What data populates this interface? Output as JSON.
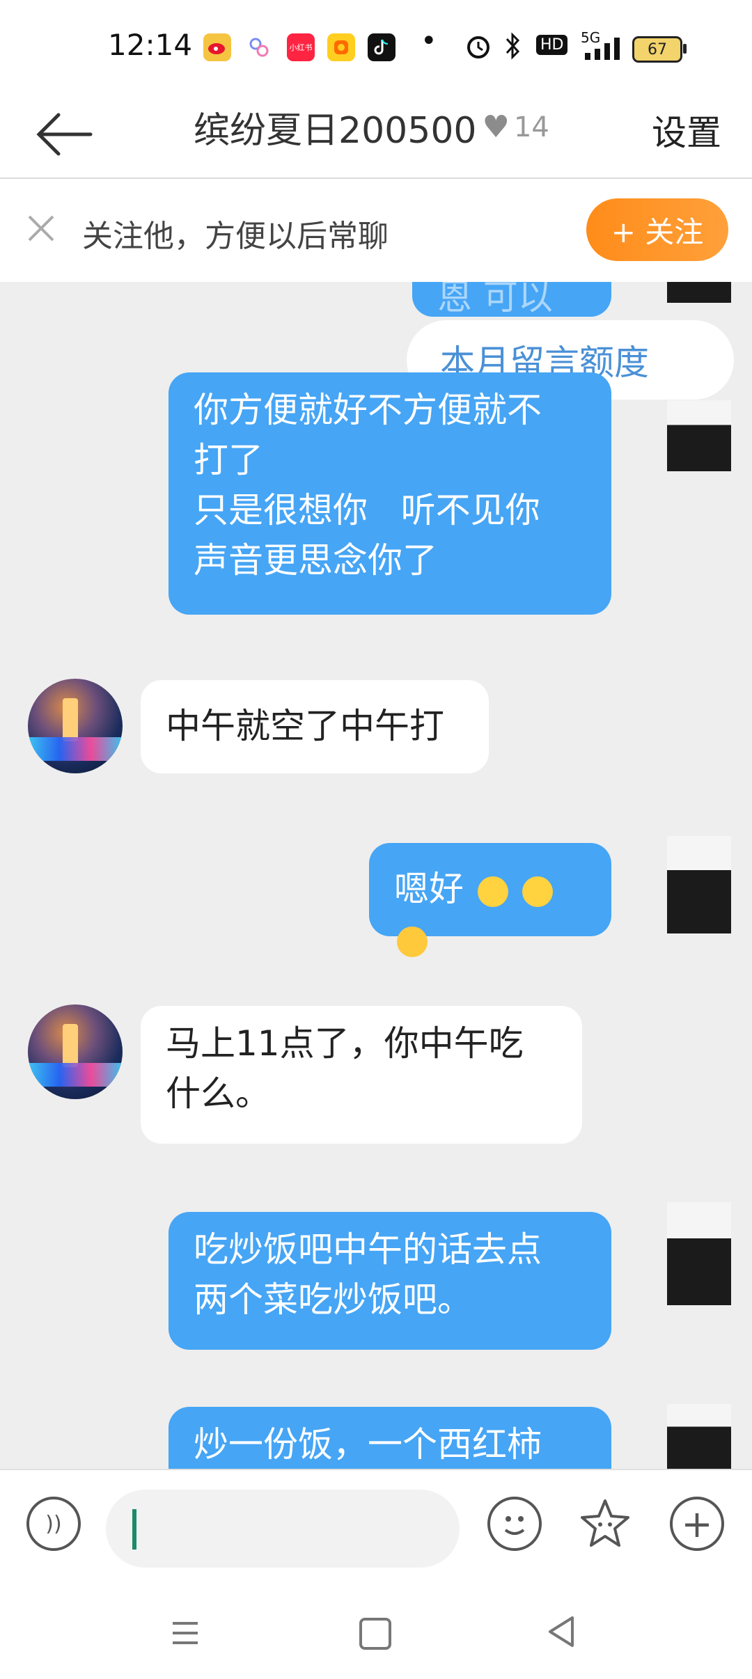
{
  "status_bar": {
    "time": "12:14",
    "app_icons": [
      "weibo-icon",
      "link-icon",
      "xiaohongshu-icon",
      "kuaishou-icon",
      "tiktok-icon"
    ],
    "dot": "•",
    "network": "5G",
    "hd": "HD",
    "battery": "67"
  },
  "header": {
    "back_label": "",
    "title": "缤纷夏日200500",
    "heart_count": "14",
    "settings_label": "设置"
  },
  "follow_bar": {
    "text": "关注他，方便以后常聊",
    "button_label": "+ 关注"
  },
  "chat": {
    "partial_top_text": "恩 可以的",
    "quota_label": "本月留言额度",
    "messages": [
      {
        "dir": "out",
        "lines": [
          "你方便就好不方便就不",
          "打了",
          "只是很想你   听不见你",
          "声音更思念你了"
        ]
      },
      {
        "dir": "in",
        "text": "中午就空了中午打"
      },
      {
        "dir": "out",
        "text": "嗯好"
      },
      {
        "dir": "in",
        "lines": [
          "马上11点了，你中午吃",
          "什么。"
        ]
      },
      {
        "dir": "out",
        "lines": [
          "吃炒饭吧中午的话去点",
          "两个菜吃炒饭吧。"
        ]
      },
      {
        "dir": "out",
        "text": "炒一份饭，一个西红柿"
      }
    ]
  },
  "input_bar": {
    "placeholder": ""
  },
  "colors": {
    "outgoing_bubble": "#46a5f5",
    "incoming_bubble": "#ffffff",
    "follow_button": "#ff8c1a",
    "background": "#eeeeee"
  }
}
